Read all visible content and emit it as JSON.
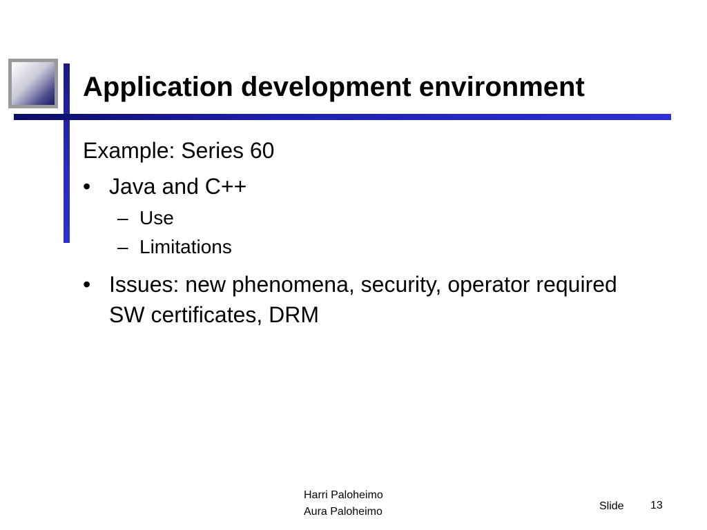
{
  "slide": {
    "title": "Application development environment",
    "intro": "Example: Series 60",
    "bullets": [
      {
        "marker": "•",
        "text": "Java and C++",
        "sub": [
          {
            "marker": "–",
            "text": "Use"
          },
          {
            "marker": "–",
            "text": "Limitations"
          }
        ]
      },
      {
        "marker": "•",
        "text": "Issues: new phenomena, security, operator required SW certificates, DRM"
      }
    ]
  },
  "footer": {
    "authors": [
      "Harri Paloheimo",
      "Aura Paloheimo"
    ],
    "slide_label": "Slide",
    "slide_number": "13"
  },
  "colors": {
    "accent_bar": "#1e1eb0",
    "square_border": "#9a9a9a",
    "text": "#000000"
  }
}
